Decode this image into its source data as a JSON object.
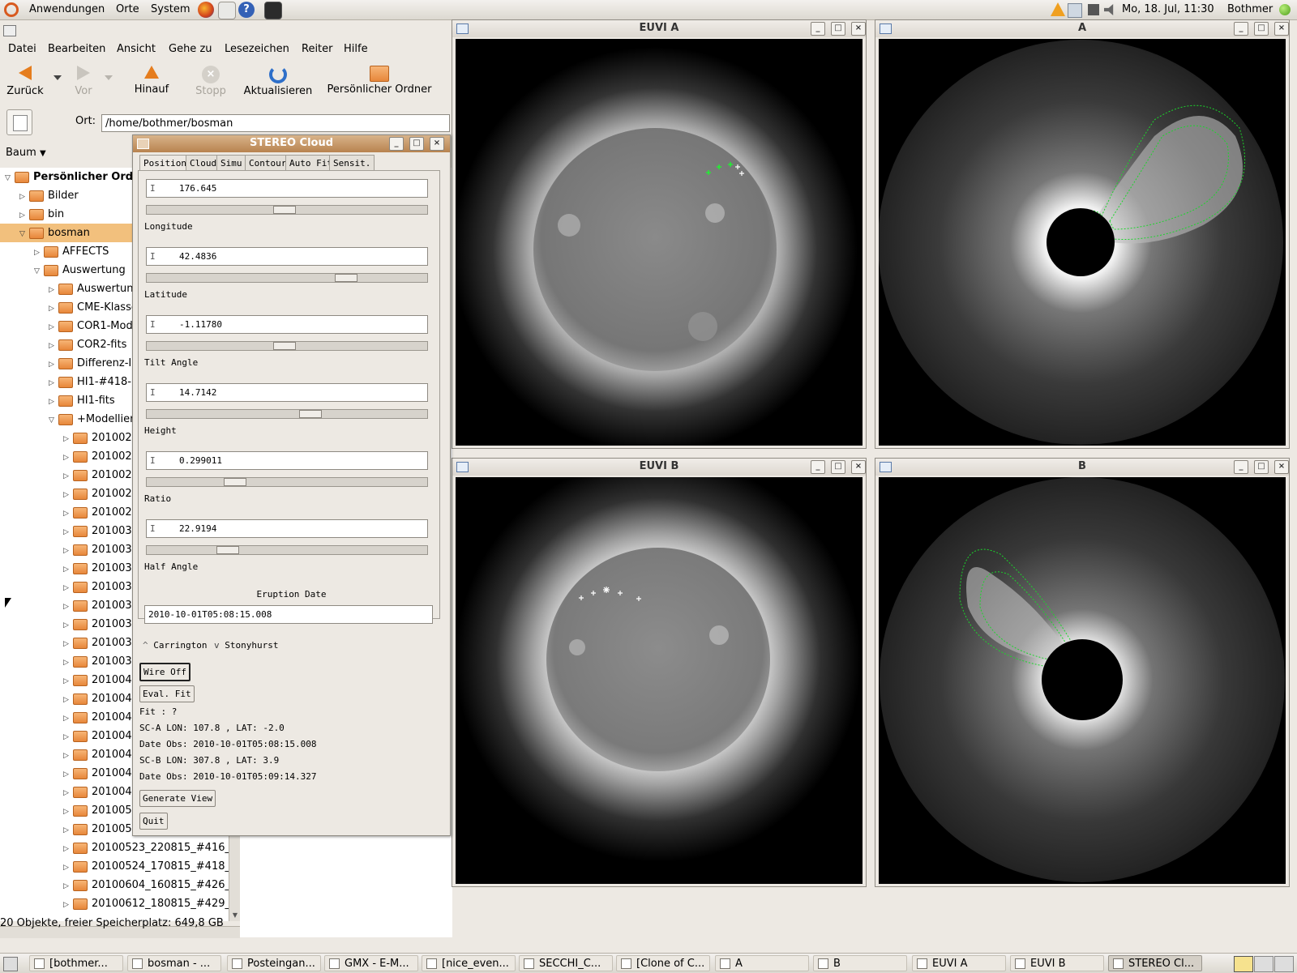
{
  "top_panel": {
    "menus": [
      "Anwendungen",
      "Orte",
      "System"
    ],
    "clock": "Mo, 18. Jul, 11:30",
    "user": "Bothmer"
  },
  "file_manager": {
    "menubar": [
      "Datei",
      "Bearbeiten",
      "Ansicht",
      "Gehe zu",
      "Lesezeichen",
      "Reiter",
      "Hilfe"
    ],
    "toolbar": {
      "back": "Zurück",
      "forward": "Vor",
      "up": "Hinauf",
      "stop": "Stopp",
      "reload": "Aktualisieren",
      "home": "Persönlicher Ordner"
    },
    "location_label": "Ort:",
    "location_value": "/home/bothmer/bosman",
    "side_pane_selector": "Baum",
    "tree": [
      "Persönlicher Ord",
      "Bilder",
      "bin",
      "bosman",
      "AFFECTS",
      "Auswertung",
      "Auswertung",
      "CME-Klasse",
      "COR1-Mode",
      "COR2-fits",
      "Differenz-I",
      "HI1-#418-F",
      "HI1-fits",
      "+Modellier",
      "2010020",
      "2010021",
      "2010021",
      "2010022",
      "2010022",
      "2010030",
      "2010030",
      "2010031",
      "2010031",
      "2010032",
      "2010032",
      "2010032",
      "2010033",
      "2010040",
      "2010040",
      "2010041",
      "2010041",
      "2010041",
      "2010041",
      "2010042",
      "2010050",
      "2010052",
      "20100523_220815_#416_",
      "20100524_170815_#418_",
      "20100604_160815_#426_",
      "20100612_180815_#429_"
    ],
    "status": "20 Objekte, freier Speicherplatz: 649,8 GB"
  },
  "stereo_cloud": {
    "title": "STEREO Cloud",
    "tabs": [
      "Position",
      "Cloud",
      "Simu",
      "Contour",
      "Auto Fit",
      "Sensit."
    ],
    "fields": [
      {
        "label": "Longitude",
        "value": "176.645",
        "slider": 0.49
      },
      {
        "label": "Latitude",
        "value": "42.4836",
        "slider": 0.73
      },
      {
        "label": "Tilt Angle",
        "value": "-1.11780",
        "slider": 0.49
      },
      {
        "label": "Height",
        "value": "14.7142",
        "slider": 0.59
      },
      {
        "label": "Ratio",
        "value": "0.299011",
        "slider": 0.3
      },
      {
        "label": "Half Angle",
        "value": "22.9194",
        "slider": 0.27
      }
    ],
    "eruption_date_label": "Eruption Date",
    "eruption_date": "2010-10-01T05:08:15.008",
    "coord_options": [
      "Carrington",
      "Stonyhurst"
    ],
    "wire_off": "Wire Off",
    "eval_fit": "Eval. Fit",
    "fit": "Fit : ?",
    "sc_a": "SC-A LON:  107.8 , LAT:  -2.0",
    "date_obs_a": "Date Obs: 2010-10-01T05:08:15.008",
    "sc_b": "SC-B LON:  307.8 , LAT:   3.9",
    "date_obs_b": "Date Obs: 2010-10-01T05:09:14.327",
    "generate_view": "Generate View",
    "quit": "Quit"
  },
  "image_windows": [
    {
      "title": "EUVI A"
    },
    {
      "title": "A"
    },
    {
      "title": "EUVI B"
    },
    {
      "title": "B"
    }
  ],
  "taskbar": [
    "[bothmer...",
    "bosman - ...",
    "Posteingan...",
    "GMX - E-M...",
    "[nice_even...",
    "SECCHI_C...",
    "[Clone of C...",
    "A",
    "B",
    "EUVI A",
    "EUVI B",
    "STEREO Cl..."
  ]
}
